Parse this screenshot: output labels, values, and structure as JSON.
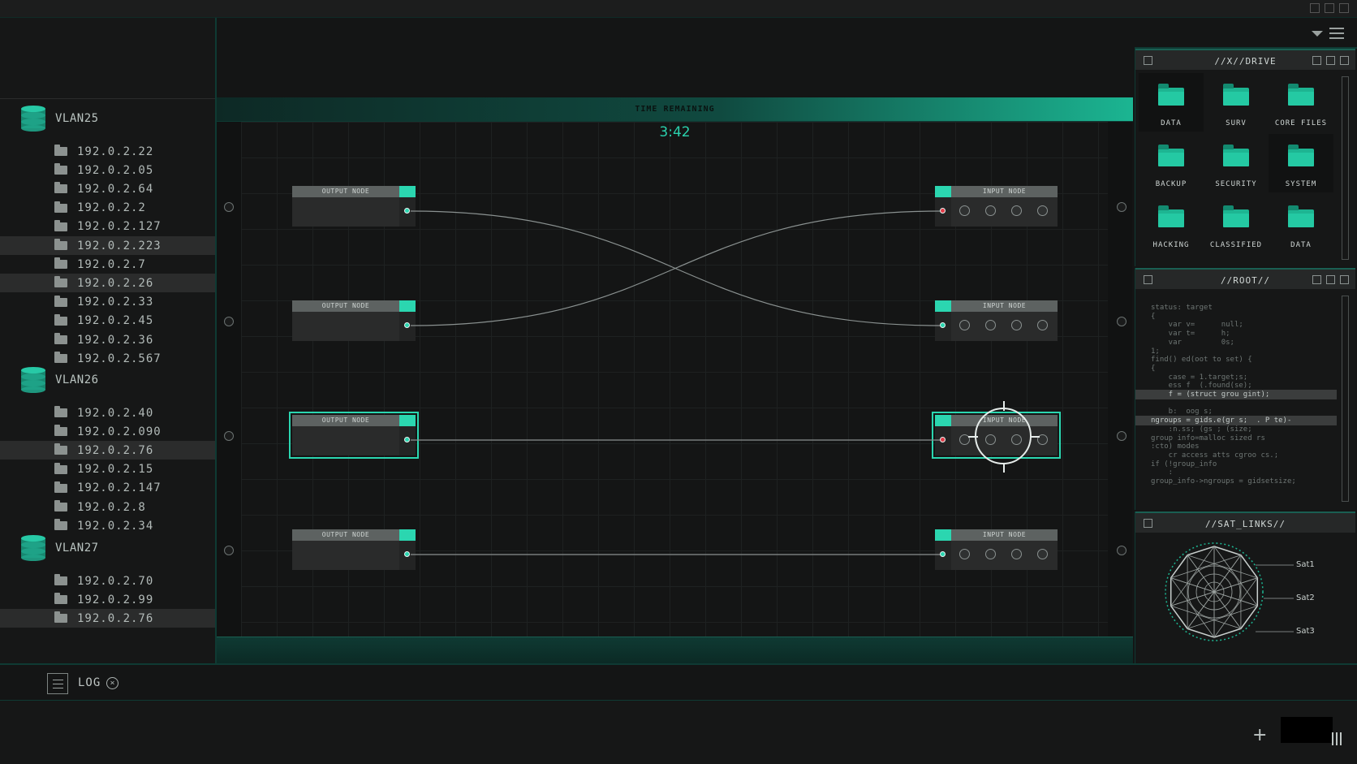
{
  "sidebar": {
    "vlans": [
      {
        "name": "VLAN25",
        "ips": [
          "192.0.2.22",
          "192.0.2.05",
          "192.0.2.64",
          "192.0.2.2",
          "192.0.2.127",
          "192.0.2.223",
          "192.0.2.7",
          "192.0.2.26",
          "192.0.2.33",
          "192.0.2.45",
          "192.0.2.36",
          "192.0.2.567"
        ]
      },
      {
        "name": "VLAN26",
        "ips": [
          "192.0.2.40",
          "192.0.2.090",
          "192.0.2.76",
          "192.0.2.15",
          "192.0.2.147",
          "192.0.2.8",
          "192.0.2.34"
        ]
      },
      {
        "name": "VLAN27",
        "ips": [
          "192.0.2.70",
          "192.0.2.99",
          "192.0.2.76"
        ]
      }
    ],
    "selected_ips": [
      "192.0.2.223",
      "192.0.2.26",
      "192.0.2.76"
    ]
  },
  "puzzle": {
    "time_label": "TIME REMAINING",
    "timer": "3:42",
    "output_label": "OUTPUT NODE",
    "input_label": "INPUT NODE",
    "connections": [
      {
        "output": 1,
        "input": 2
      },
      {
        "output": 2,
        "input": 1
      },
      {
        "output": 3,
        "input": 3
      },
      {
        "output": 4,
        "input": 4
      }
    ],
    "input_status": [
      "error",
      "ok",
      "error",
      "ok"
    ],
    "highlighted_row": 3
  },
  "drive": {
    "title": "//X//DRIVE",
    "items": [
      "DATA",
      "SURV",
      "CORE FILES",
      "BACKUP",
      "SECURITY",
      "SYSTEM",
      "HACKING",
      "CLASSIFIED",
      "DATA"
    ]
  },
  "root": {
    "title": "//ROOT//",
    "lines": [
      "status: target",
      "{",
      "    var v=      null;",
      "    var t=      h;",
      "    var         0s;",
      "1;",
      "find() ed(oot to set) {",
      "{",
      "    case = 1.target;s;",
      "    ess f  (.found(se);",
      "    f = (struct grou gint);",
      "",
      "    b:  oog s;",
      "ngroups = gids.e(gr s;  . P te)-",
      "    :n.ss; (gs ; (size;",
      "group info=malloc sized rs",
      ":cto) modes",
      "    cr access atts cgroo cs.;",
      "if (!group_info",
      "    :",
      "group_info->ngroups = gidsetsize;"
    ]
  },
  "sat_links": {
    "title": "//SAT_LINKS//",
    "labels": [
      "Sat1",
      "Sat2",
      "Sat3"
    ]
  },
  "log": {
    "label": "LOG"
  },
  "icons": {
    "vlan": "database-icon",
    "ip": "folder-icon",
    "drive_item": "folder-icon",
    "log": "menu-icon",
    "close": "close-circle-icon",
    "add": "plus-icon",
    "layout": "bars-icon",
    "dropdown": "chevron-down-icon",
    "menu": "hamburger-icon"
  },
  "colors": {
    "accent": "#2bd6b0",
    "error": "#e23a47",
    "background": "#141515",
    "panel": "#161717"
  }
}
